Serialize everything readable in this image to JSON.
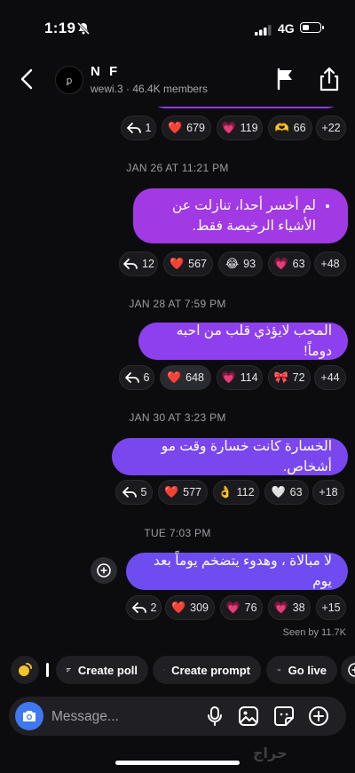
{
  "status": {
    "time": "1:19",
    "network": "4G"
  },
  "header": {
    "title": "N F",
    "subtitle": "wewi.3 · 46.4K members",
    "avatar_text": "ꝑ"
  },
  "rows": [
    {
      "reply": "1",
      "r": [
        {
          "emoji": "❤️",
          "count": "679"
        },
        {
          "emoji": "💗",
          "count": "119"
        },
        {
          "emoji": "🫶",
          "count": "66"
        }
      ],
      "more": "+22"
    },
    {
      "reply": "12",
      "r": [
        {
          "emoji": "❤️",
          "count": "567"
        },
        {
          "emoji": "😂",
          "count": "93"
        },
        {
          "emoji": "💗",
          "count": "63"
        }
      ],
      "more": "+48"
    },
    {
      "reply": "6",
      "r": [
        {
          "emoji": "❤️",
          "count": "648"
        },
        {
          "emoji": "💗",
          "count": "114"
        },
        {
          "emoji": "🎀",
          "count": "72"
        }
      ],
      "more": "+44"
    },
    {
      "reply": "5",
      "r": [
        {
          "emoji": "❤️",
          "count": "577"
        },
        {
          "emoji": "👌",
          "count": "112"
        },
        {
          "emoji": "🤍",
          "count": "63"
        }
      ],
      "more": "+18"
    },
    {
      "reply": "2",
      "r": [
        {
          "emoji": "❤️",
          "count": "309"
        },
        {
          "emoji": "💗",
          "count": "76"
        },
        {
          "emoji": "💗",
          "count": "38"
        }
      ],
      "more": "+15"
    }
  ],
  "dates": [
    "JAN 26 AT 11:21 PM",
    "JAN 28 AT 7:59 PM",
    "JAN 30 AT 3:23 PM",
    "TUE 7:03 PM"
  ],
  "messages": [
    "لم أخسر أحدا، تنازلت عن الأشياء الرخيصة فقط.",
    "المحب لايؤذي قلب من احبه دوماً!",
    "الخسارة كانت خسارة وقت مو أشخاص.",
    "لا مبالاة ، وهدوء يتضخم يوماً بعد يوم"
  ],
  "seen": "Seen by 11.7K",
  "actions": {
    "poll": "Create poll",
    "prompt": "Create prompt",
    "live": "Go live"
  },
  "composer": {
    "placeholder": "Message..."
  },
  "watermark": "حراج",
  "colors": {
    "bubble1": "#a139e4",
    "bubble4": "#6e4cf0",
    "camera": "#3f78ef",
    "chip": "#1b1b1f"
  }
}
